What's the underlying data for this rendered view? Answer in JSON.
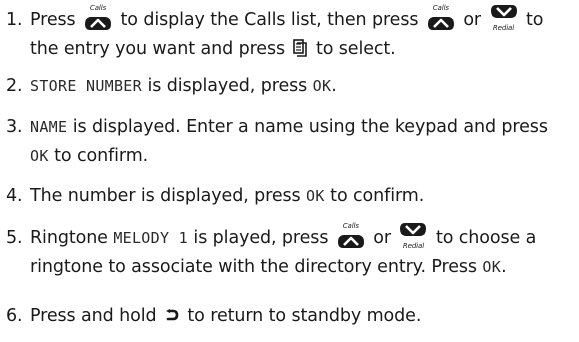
{
  "icons": {
    "calls_caption": "Calls",
    "redial_caption": "Redial",
    "up_icon": "calls-up-button-icon",
    "down_icon": "redial-down-button-icon",
    "menu_icon": "menu-select-icon",
    "back_icon": "back-arrow-icon"
  },
  "steps": [
    {
      "num": "1.",
      "a": "Press",
      "b": "to display the Calls list, then press",
      "c": "or",
      "d": "to",
      "e": "the entry you want and press",
      "f": "to select."
    },
    {
      "num": "2.",
      "lcd1": "STORE NUMBER",
      "a": " is displayed, press ",
      "lcd2": "OK",
      "b": "."
    },
    {
      "num": "3.",
      "lcd1": "NAME",
      "a": " is displayed. Enter a name using the keypad and press",
      "lcd2": "OK",
      "b": " to confirm."
    },
    {
      "num": "4.",
      "a": "The number is displayed, press ",
      "lcd1": "OK",
      "b": " to confirm."
    },
    {
      "num": "5.",
      "a": "Ringtone ",
      "lcd1": "MELODY 1",
      "b": " is played, press",
      "c": "or",
      "d": "to choose a",
      "e": "ringtone to associate with the directory entry. Press ",
      "lcd2": "OK",
      "f": "."
    },
    {
      "num": "6.",
      "a": "Press and hold",
      "b": "to return to standby mode."
    }
  ],
  "colors": {
    "text": "#1a1a1a",
    "icon": "#1a1a1a"
  }
}
